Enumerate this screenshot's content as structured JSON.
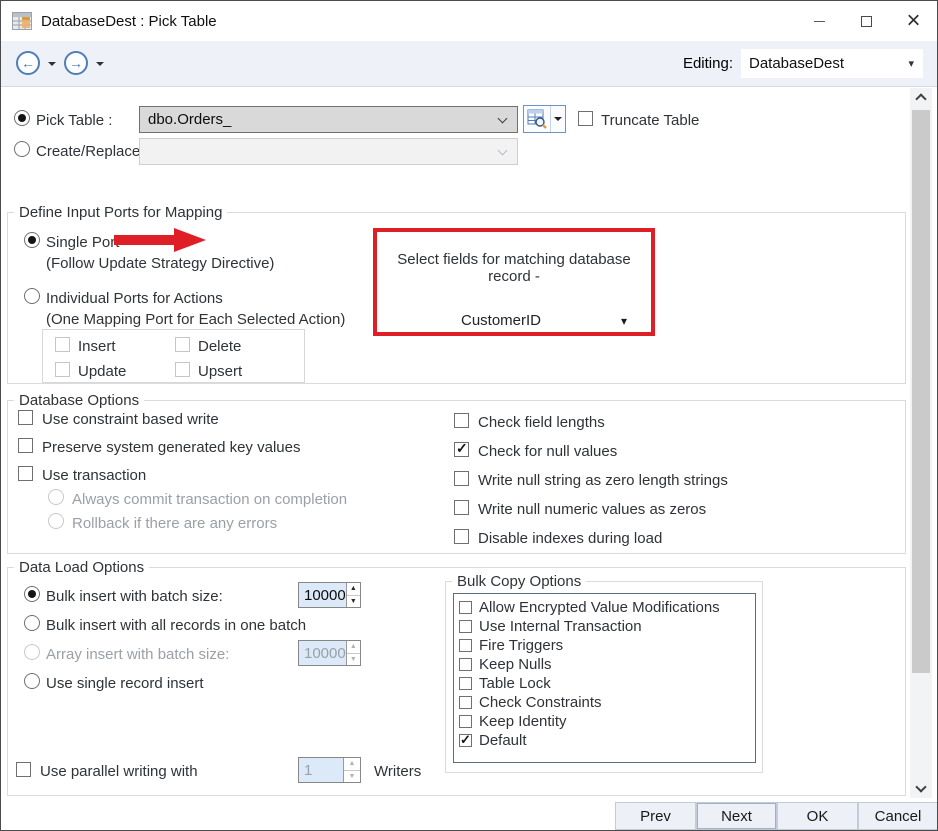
{
  "titlebar": {
    "title": "DatabaseDest : Pick Table"
  },
  "toolbar": {
    "editing_label": "Editing:",
    "editing_value": "DatabaseDest"
  },
  "icons": {
    "check": "✓",
    "caret_down": "▾",
    "spin_up": "▲",
    "spin_down": "▼",
    "back_arrow": "←",
    "forward_arrow": "→",
    "close": "×"
  },
  "table_picker": {
    "pick_table_label": "Pick Table :",
    "pick_table_value": "dbo.Orders_",
    "create_replace_label": "Create/Replace:",
    "create_replace_value": "",
    "truncate_table_label": "Truncate Table"
  },
  "input_ports": {
    "group_title": "Define Input Ports for Mapping",
    "single_port_label": "Single Port",
    "single_port_sublabel": "(Follow Update Strategy Directive)",
    "individual_ports_label": "Individual Ports for Actions",
    "individual_ports_sublabel": "(One Mapping Port for Each Selected Action)",
    "actions": [
      {
        "label": "Insert",
        "checked": false
      },
      {
        "label": "Delete",
        "checked": false
      },
      {
        "label": "Update",
        "checked": false
      },
      {
        "label": "Upsert",
        "checked": false
      }
    ],
    "matching": {
      "prompt": "Select fields for matching database record -",
      "selected_field": "CustomerID"
    }
  },
  "database_options": {
    "group_title": "Database Options",
    "left": [
      {
        "label": "Use constraint based write",
        "checked": false
      },
      {
        "label": "Preserve system generated key values",
        "checked": false
      },
      {
        "label": "Use transaction",
        "checked": false
      }
    ],
    "transaction_radios": [
      {
        "label": "Always commit transaction on completion",
        "selected": false
      },
      {
        "label": "Rollback if there are any errors",
        "selected": false
      }
    ],
    "right": [
      {
        "label": "Check field lengths",
        "checked": false
      },
      {
        "label": "Check for null values",
        "checked": true
      },
      {
        "label": "Write null string as zero length strings",
        "checked": false
      },
      {
        "label": "Write null numeric values as zeros",
        "checked": false
      },
      {
        "label": "Disable indexes during load",
        "checked": false
      }
    ]
  },
  "data_load_options": {
    "group_title": "Data Load Options",
    "bulk_batch_label": "Bulk insert with batch size:",
    "bulk_batch_value": "10000",
    "bulk_all_label": "Bulk insert with all records in one batch",
    "array_batch_label": "Array insert with batch size:",
    "array_batch_value": "10000",
    "single_record_label": "Use single record insert",
    "parallel_label": "Use parallel writing with",
    "parallel_value": "1",
    "parallel_suffix": "Writers"
  },
  "bulk_copy": {
    "group_title": "Bulk Copy Options",
    "items": [
      {
        "label": "Allow Encrypted Value Modifications",
        "checked": false
      },
      {
        "label": "Use Internal Transaction",
        "checked": false
      },
      {
        "label": "Fire Triggers",
        "checked": false
      },
      {
        "label": "Keep Nulls",
        "checked": false
      },
      {
        "label": "Table Lock",
        "checked": false
      },
      {
        "label": "Check Constraints",
        "checked": false
      },
      {
        "label": "Keep Identity",
        "checked": false
      },
      {
        "label": "Default",
        "checked": true
      }
    ]
  },
  "footer": {
    "buttons": [
      "Prev",
      "Next",
      "OK",
      "Cancel"
    ]
  },
  "colors": {
    "annotation_red": "#df1f26",
    "nav_blue": "#4f7dba",
    "spinner_bg": "#dbe9f8",
    "toolbar_bg": "#eef2f8"
  }
}
